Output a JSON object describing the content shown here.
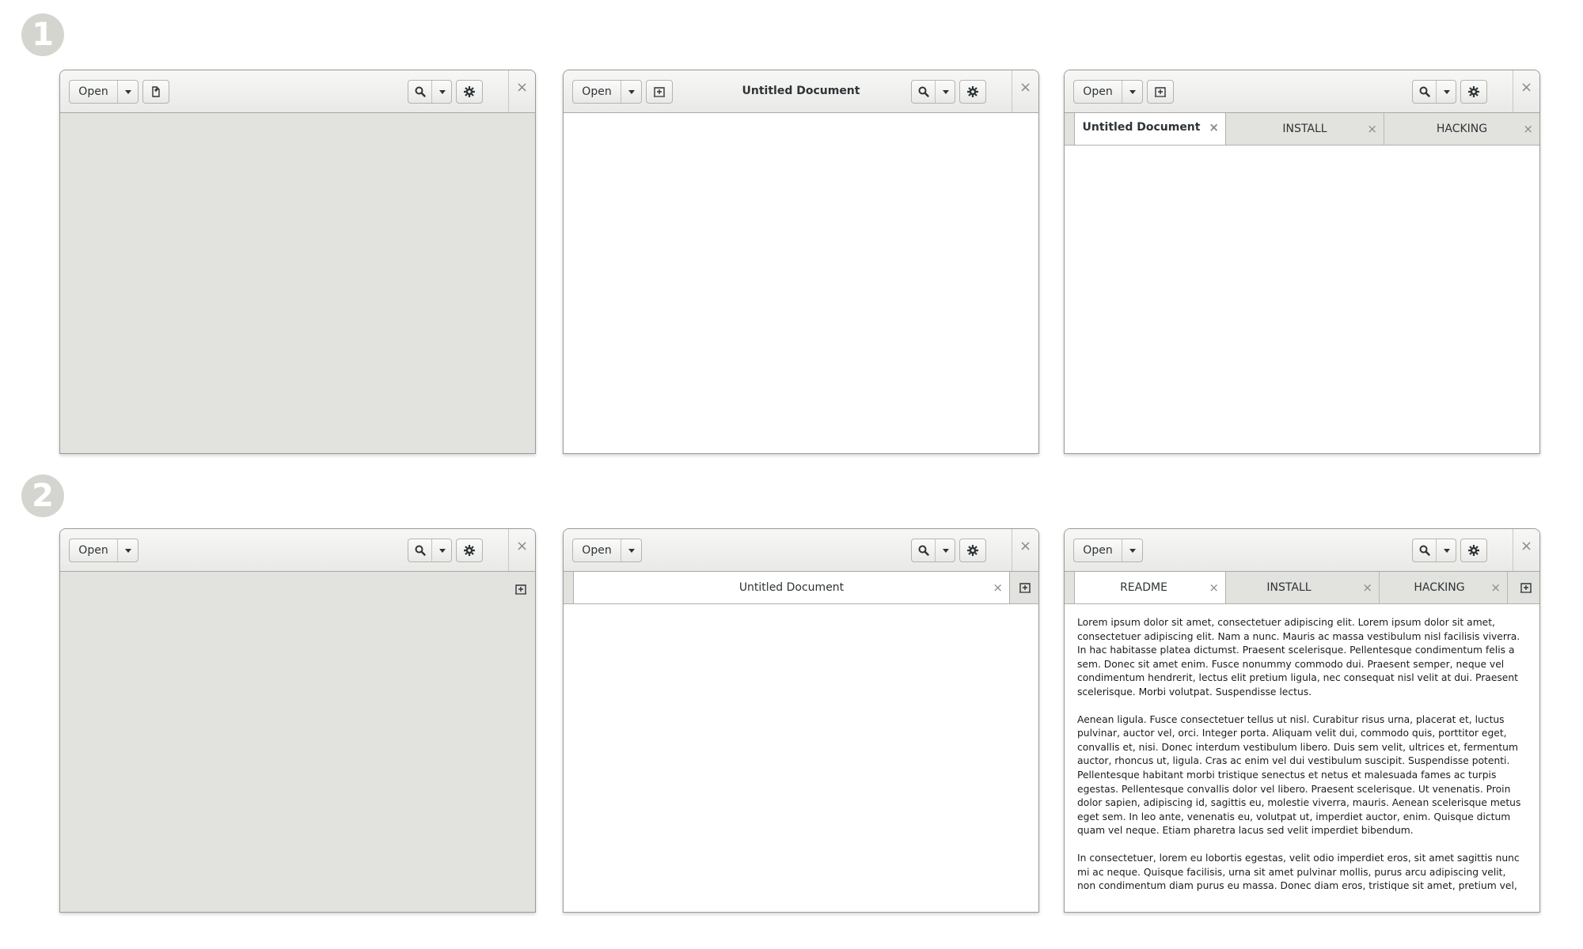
{
  "steps": [
    "1",
    "2"
  ],
  "headerbar": {
    "open_label": "Open",
    "close_glyph": "×",
    "dropdown_icon": "pan-down-icon",
    "search_icon": "search-icon",
    "gear_icon": "gear-icon",
    "new_document_icon": "new-document-icon",
    "new_tab_icon": "new-tab-icon"
  },
  "windows": {
    "w1": {},
    "w2": {
      "title": "Untitled Document"
    },
    "w3": {
      "tabs": [
        "Untitled Document",
        "INSTALL",
        "HACKING"
      ]
    },
    "w4": {},
    "w5": {
      "tabs": [
        "Untitled Document"
      ]
    },
    "w6": {
      "tabs": [
        "README",
        "INSTALL",
        "HACKING"
      ],
      "paragraphs": [
        "Lorem ipsum dolor sit amet, consectetuer adipiscing elit. Lorem ipsum dolor sit amet, consectetuer adipiscing elit. Nam a nunc. Mauris ac massa vestibulum nisl facilisis viverra. In hac habitasse platea dictumst. Praesent scelerisque. Pellentesque condimentum felis a sem. Donec sit amet enim. Fusce nonummy commodo dui. Praesent semper, neque vel condimentum hendrerit, lectus elit pretium ligula, nec consequat nisl velit at dui. Praesent scelerisque. Morbi volutpat. Suspendisse lectus.",
        "Aenean ligula. Fusce consectetuer tellus ut nisl. Curabitur risus urna, placerat et, luctus pulvinar, auctor vel, orci. Integer porta. Aliquam velit dui, commodo quis, porttitor eget, convallis et, nisi. Donec interdum vestibulum libero. Duis sem velit, ultrices et, fermentum auctor, rhoncus ut, ligula. Cras ac enim vel dui vestibulum suscipit. Suspendisse potenti. Pellentesque habitant morbi tristique senectus et netus et malesuada fames ac turpis egestas. Pellentesque convallis dolor vel libero. Praesent scelerisque. Ut venenatis. Proin dolor sapien, adipiscing id, sagittis eu, molestie viverra, mauris. Aenean scelerisque metus eget sem. In leo ante, venenatis eu, volutpat ut, imperdiet auctor, enim. Quisque dictum quam vel neque. Etiam pharetra lacus sed velit imperdiet bibendum.",
        "In consectetuer, lorem eu lobortis egestas, velit odio imperdiet eros, sit amet sagittis nunc mi ac neque. Quisque facilisis, urna sit amet pulvinar mollis, purus arcu adipiscing velit, non condimentum diam purus eu massa. Donec diam eros, tristique sit amet, pretium vel,"
      ]
    }
  },
  "colors": {
    "placeholder_gray": "#e2e2df",
    "step_badge": "#d5d5d0",
    "border": "#9a9a96"
  }
}
